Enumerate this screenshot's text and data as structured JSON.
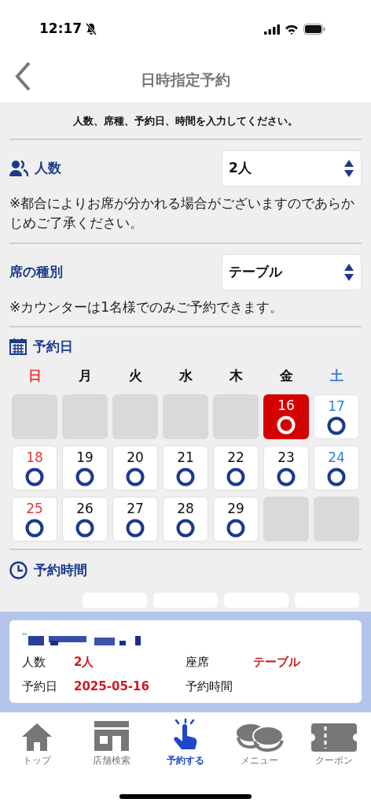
{
  "status_bar": {
    "time": "12:17"
  },
  "header": {
    "title": "日時指定予約"
  },
  "instruction": "人数、席種、予約日、時間を入力してください。",
  "party": {
    "label": "人数",
    "value": "2人",
    "note": "※都合によりお席が分かれる場合がございますのであらかじめご了承ください。"
  },
  "seat": {
    "label": "席の種別",
    "value": "テーブル",
    "note": "※カウンターは1名様でのみご予約できます。"
  },
  "date": {
    "label": "予約日",
    "weekdays": [
      {
        "label": "日",
        "kind": "sunday"
      },
      {
        "label": "月",
        "kind": "weekday"
      },
      {
        "label": "火",
        "kind": "weekday"
      },
      {
        "label": "水",
        "kind": "weekday"
      },
      {
        "label": "木",
        "kind": "weekday"
      },
      {
        "label": "金",
        "kind": "weekday"
      },
      {
        "label": "土",
        "kind": "saturday"
      }
    ],
    "cells": [
      {
        "kind": "blank"
      },
      {
        "kind": "blank"
      },
      {
        "kind": "blank"
      },
      {
        "kind": "blank"
      },
      {
        "kind": "blank"
      },
      {
        "kind": "weekday",
        "day": "16",
        "available": true,
        "selected": true
      },
      {
        "kind": "saturday",
        "day": "17",
        "available": true,
        "selected": false
      },
      {
        "kind": "sunday",
        "day": "18",
        "available": true,
        "selected": false
      },
      {
        "kind": "weekday",
        "day": "19",
        "available": true,
        "selected": false
      },
      {
        "kind": "weekday",
        "day": "20",
        "available": true,
        "selected": false
      },
      {
        "kind": "weekday",
        "day": "21",
        "available": true,
        "selected": false
      },
      {
        "kind": "weekday",
        "day": "22",
        "available": true,
        "selected": false
      },
      {
        "kind": "weekday",
        "day": "23",
        "available": true,
        "selected": false
      },
      {
        "kind": "saturday",
        "day": "24",
        "available": true,
        "selected": false
      },
      {
        "kind": "sunday",
        "day": "25",
        "available": true,
        "selected": false
      },
      {
        "kind": "weekday",
        "day": "26",
        "available": true,
        "selected": false
      },
      {
        "kind": "weekday",
        "day": "27",
        "available": true,
        "selected": false
      },
      {
        "kind": "weekday",
        "day": "28",
        "available": true,
        "selected": false
      },
      {
        "kind": "weekday",
        "day": "29",
        "available": true,
        "selected": false
      },
      {
        "kind": "blank"
      },
      {
        "kind": "blank"
      }
    ]
  },
  "time": {
    "label": "予約時間"
  },
  "summary": {
    "items": [
      {
        "label": "人数",
        "value": "2人"
      },
      {
        "label": "座席",
        "value": "テーブル"
      },
      {
        "label": "予約日",
        "value": "2025-05-16"
      },
      {
        "label": "予約時間"
      }
    ]
  },
  "tab_bar": [
    {
      "label": "トップ",
      "selected": false
    },
    {
      "label": "店舗検索",
      "selected": false
    },
    {
      "label": "予約する",
      "selected": true
    },
    {
      "label": "メニュー",
      "selected": false
    },
    {
      "label": "クーポン",
      "selected": false
    }
  ]
}
